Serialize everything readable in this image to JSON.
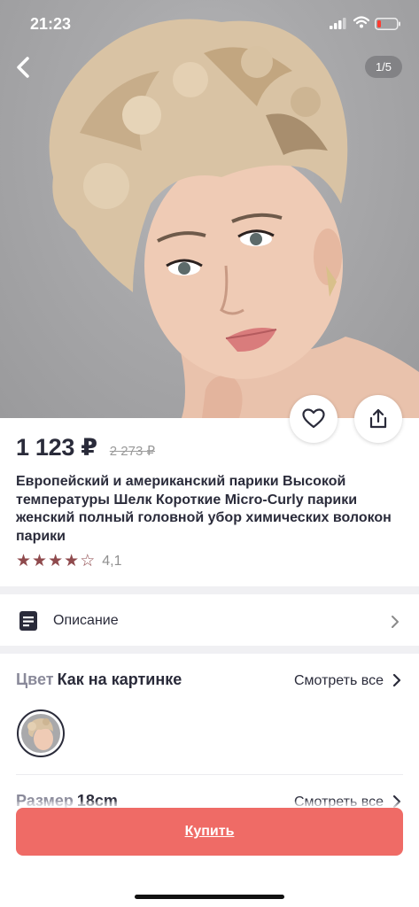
{
  "status_bar": {
    "time": "21:23"
  },
  "gallery": {
    "counter": "1/5"
  },
  "product": {
    "price": "1 123 ₽",
    "old_price": "2 273 ₽",
    "title": "Европейский и американский парики Высокой температуры Шелк Короткие Micro-Curly парики женский полный головной убор химических волокон парики",
    "rating": 4.1,
    "rating_label": "4,1"
  },
  "description": {
    "label": "Описание"
  },
  "color_option": {
    "name": "Цвет",
    "value": "Как на картинке",
    "see_all": "Смотреть все"
  },
  "size_option": {
    "name": "Размер",
    "value": "18cm",
    "see_all": "Смотреть все"
  },
  "buy_button": {
    "label": "Купить"
  },
  "colors": {
    "accent": "#ef6b66",
    "star": "#8f4a4d",
    "text": "#2a2b3a"
  },
  "icons": [
    "back-icon",
    "heart-icon",
    "share-icon",
    "document-icon",
    "chevron-right-icon",
    "star-icon"
  ]
}
